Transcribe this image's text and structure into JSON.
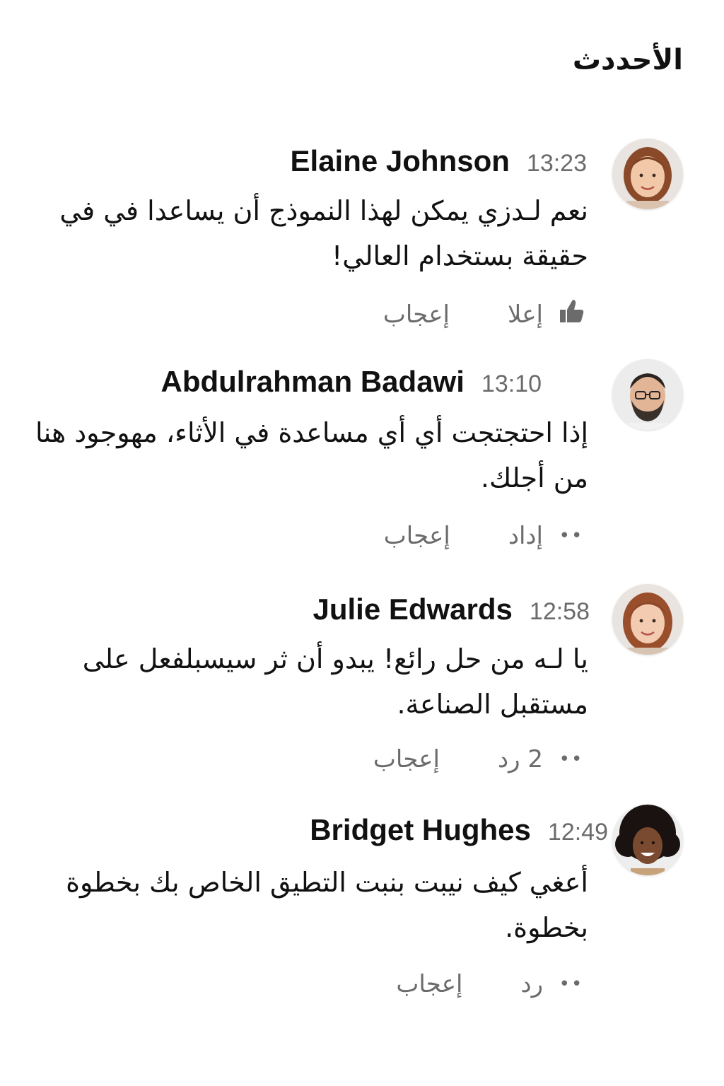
{
  "header": {
    "title": "الأحددث"
  },
  "comments": [
    {
      "author": "Elaine Johnson",
      "time": "13:23",
      "text": "نعم لـدزي يمكن لهذا النموذج أن يساعدا في في حقيقة بستخدام العالي!",
      "reply_label": "إعلا",
      "like_label": "إعجاب",
      "icon": "thumbs-up-icon"
    },
    {
      "author": "Abdulrahman Badawi",
      "time": "13:10",
      "text": "إذا احتجتجت أي أي مساعدة في الأثاء، مهوجود هنا من أجلك.",
      "reply_label": "إداد",
      "like_label": "إعجاب",
      "icon": "more-dots-icon"
    },
    {
      "author": "Julie Edwards",
      "time": "12:58",
      "text": "يا لـه من حل رائع! يبدو أن ثر سيسبلفعل على مستقبل الصناعة.",
      "reply_label": "2 رد",
      "like_label": "إعجاب",
      "icon": "more-dots-icon"
    },
    {
      "author": "Bridget Hughes",
      "time": "12:49",
      "text": "أعغي كيف نيبت بنبت التطيق الخاص بك بخطوة بخطوة.",
      "reply_label": "رد",
      "like_label": "إعجاب",
      "icon": "more-dots-icon"
    }
  ]
}
